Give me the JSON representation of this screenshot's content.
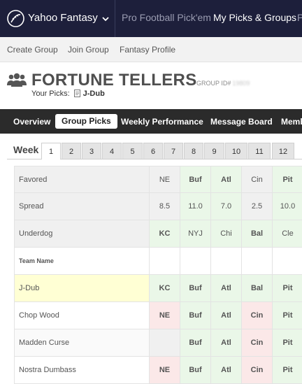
{
  "header": {
    "brand": "Yahoo Fantasy",
    "links": [
      "Pro Football Pick'em",
      "My Picks & Groups",
      "P"
    ]
  },
  "subnav": [
    "Create Group",
    "Join Group",
    "Fantasy Profile"
  ],
  "group": {
    "title": "FORTUNE TELLERS",
    "id_label": "GROUP ID#",
    "id_value": "19809",
    "your_picks_label": "Your Picks:",
    "your_picks_name": "J-Dub"
  },
  "tabs": [
    "Overview",
    "Group Picks",
    "Weekly Performance",
    "Message Board",
    "Memb"
  ],
  "active_tab": "Group Picks",
  "week": {
    "label": "Week",
    "numbers": [
      "1",
      "2",
      "3",
      "4",
      "5",
      "6",
      "7",
      "8",
      "9",
      "10",
      "11",
      "12"
    ],
    "selected": "1"
  },
  "table": {
    "favored": {
      "label": "Favored",
      "values": [
        "NE",
        "Buf",
        "Atl",
        "Cin",
        "Pit"
      ]
    },
    "spread": {
      "label": "Spread",
      "values": [
        "8.5",
        "11.0",
        "7.0",
        "2.5",
        "10.0"
      ]
    },
    "underdog": {
      "label": "Underdog",
      "values": [
        "KC",
        "NYJ",
        "Chi",
        "Bal",
        "Cle"
      ]
    },
    "team_name_header": "Team Name",
    "teams": [
      {
        "name": "J-Dub",
        "picks": [
          "KC",
          "Buf",
          "Atl",
          "Bal",
          "Pit"
        ],
        "results": [
          "correct",
          "correct",
          "correct",
          "correct",
          "correct"
        ]
      },
      {
        "name": "Chop Wood",
        "picks": [
          "NE",
          "Buf",
          "Atl",
          "Cin",
          "Pit"
        ],
        "results": [
          "wrong",
          "correct",
          "correct",
          "wrong",
          "correct"
        ]
      },
      {
        "name": "Madden Curse",
        "picks": [
          "",
          "Buf",
          "Atl",
          "Cin",
          "Pit"
        ],
        "results": [
          "none",
          "correct",
          "correct",
          "wrong",
          "correct"
        ]
      },
      {
        "name": "Nostra Dumbass",
        "picks": [
          "NE",
          "Buf",
          "Atl",
          "Cin",
          "Pit"
        ],
        "results": [
          "wrong",
          "correct",
          "correct",
          "wrong",
          "correct"
        ]
      }
    ]
  },
  "colors": {
    "topbar": "#1d1f3b",
    "tabbar": "#2b2b2b",
    "correct": "#2c7a2c",
    "wrong": "#c0392b",
    "link": "#2b6ab5"
  }
}
